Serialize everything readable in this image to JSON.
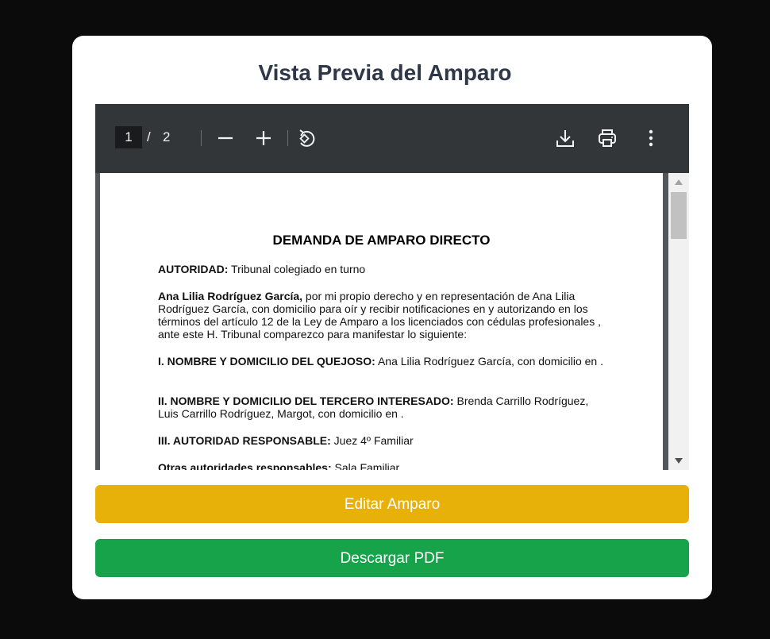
{
  "modal": {
    "title": "Vista Previa del Amparo"
  },
  "viewer": {
    "current_page": "1",
    "page_separator": "/",
    "total_pages": "2",
    "icons": [
      "zoom-out-icon",
      "zoom-in-icon",
      "rotate-icon",
      "download-icon",
      "print-icon",
      "more-options-icon"
    ]
  },
  "document": {
    "title": "DEMANDA DE AMPARO DIRECTO",
    "autoridad_label": "AUTORIDAD:",
    "autoridad_value": " Tribunal colegiado en turno",
    "intro_name": "Ana Lilia Rodríguez García,",
    "intro_text": " por mi propio derecho y en representación de Ana Lilia Rodríguez García, con domicilio para oír y recibir notificaciones en y autorizando en los términos del artículo 12 de la Ley de Amparo a los licenciados con cédulas profesionales , ante este H. Tribunal comparezco para manifestar lo siguiente:",
    "quejoso_label": "I. NOMBRE Y DOMICILIO DEL QUEJOSO:",
    "quejoso_value": " Ana Lilia Rodríguez García, con domicilio en .",
    "tercero_label": "II. NOMBRE Y DOMICILIO DEL TERCERO INTERESADO:",
    "tercero_value": " Brenda Carrillo Rodríguez, Luis Carrillo Rodríguez, Margot, con domicilio en .",
    "responsable_label": "III. AUTORIDAD RESPONSABLE:",
    "responsable_value": " Juez 4º Familiar",
    "otras_label": "Otras autoridades responsables:",
    "otras_value": " Sala Familiar"
  },
  "actions": {
    "edit_label": "Editar Amparo",
    "download_label": "Descargar PDF"
  },
  "colors": {
    "overlay": "#0b0b0b",
    "toolbar": "#323639",
    "edit_button": "#e8b10a",
    "download_button": "#16a34a",
    "title_text": "#2d3748"
  }
}
